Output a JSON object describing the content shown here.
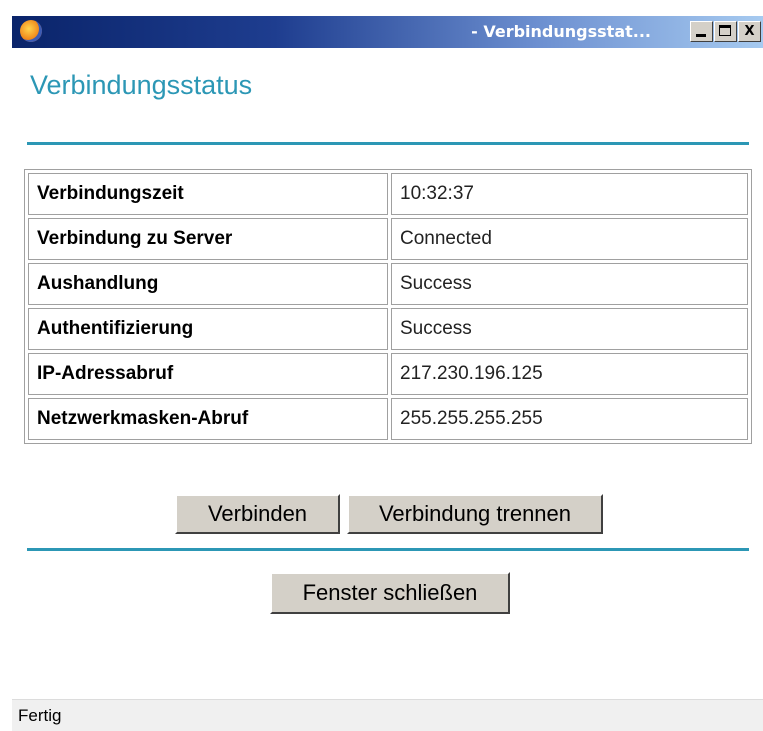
{
  "window": {
    "title": "- Verbindungsstat...",
    "min_icon": "minimize-icon",
    "max_icon": "maximize-icon",
    "close_icon": "close-icon",
    "close_glyph": "X"
  },
  "page": {
    "title": "Verbindungsstatus"
  },
  "status_table": {
    "rows": [
      {
        "label": "Verbindungszeit",
        "value": "10:32:37"
      },
      {
        "label": "Verbindung zu Server",
        "value": "Connected"
      },
      {
        "label": "Aushandlung",
        "value": "Success"
      },
      {
        "label": "Authentifizierung",
        "value": "Success"
      },
      {
        "label": "IP-Adressabruf",
        "value": "217.230.196.125"
      },
      {
        "label": "Netzwerkmasken-Abruf",
        "value": "255.255.255.255"
      }
    ]
  },
  "buttons": {
    "connect": "Verbinden",
    "disconnect": "Verbindung trennen",
    "close_window": "Fenster schließen"
  },
  "statusbar": {
    "text": "Fertig"
  },
  "colors": {
    "accent": "#2c97b5",
    "titlebar_dark": "#0a246a",
    "button_face": "#d4d0c8"
  }
}
